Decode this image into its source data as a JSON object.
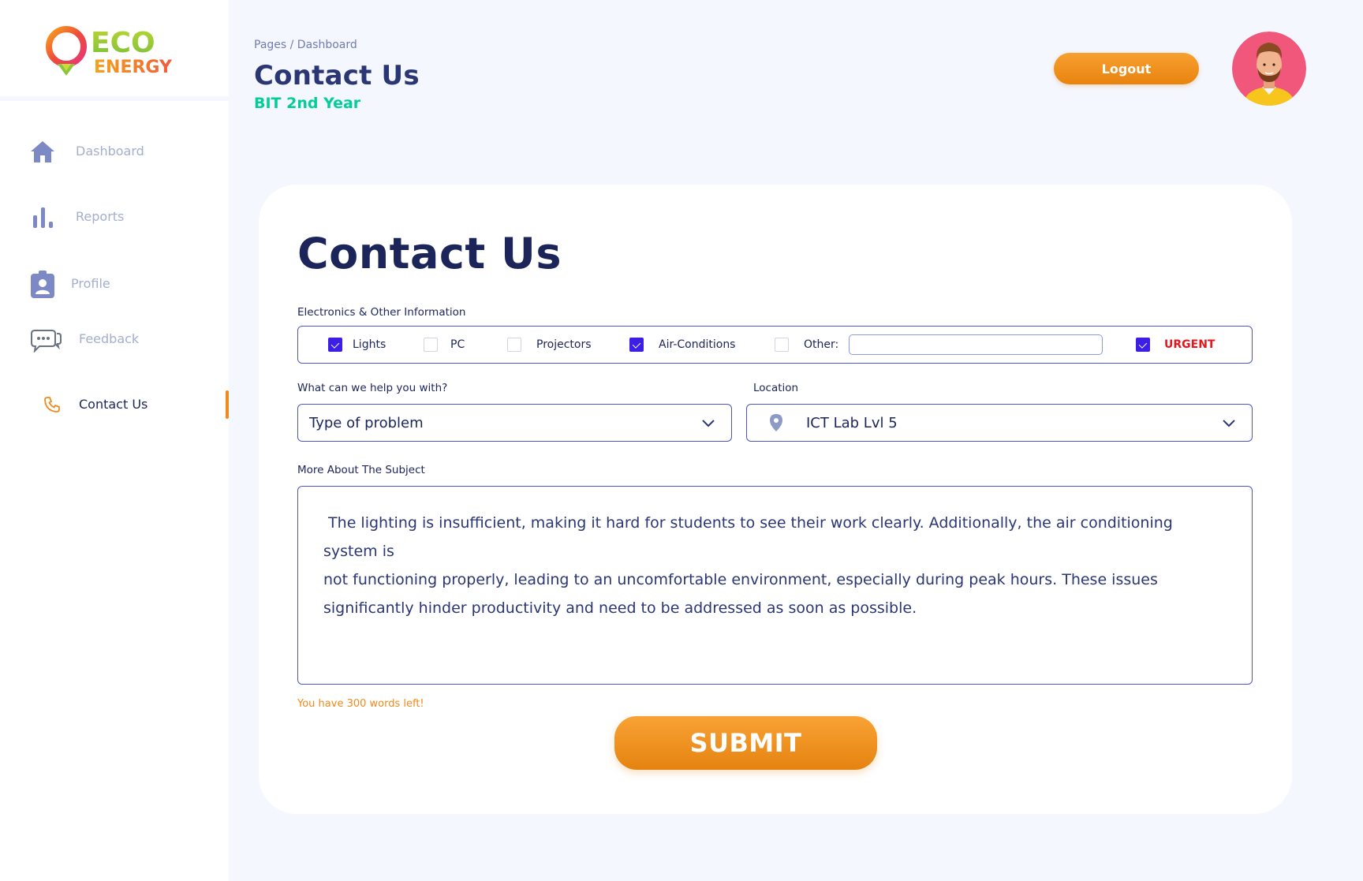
{
  "brand": {
    "line1": "ECO",
    "line2": "ENERGY"
  },
  "sidebar": {
    "items": [
      {
        "label": "Dashboard",
        "icon": "home-icon"
      },
      {
        "label": "Reports",
        "icon": "bar-chart-icon"
      },
      {
        "label": "Profile",
        "icon": "badge-icon"
      },
      {
        "label": "Feedback",
        "icon": "chat-bubbles-icon"
      },
      {
        "label": "Contact Us",
        "icon": "phone-icon",
        "active": true
      }
    ]
  },
  "header": {
    "breadcrumb": "Pages / Dashboard",
    "title": "Contact Us",
    "subtitle": "BIT 2nd Year",
    "logout_label": "Logout"
  },
  "form": {
    "title": "Contact Us",
    "electronics_label": "Electronics & Other Information",
    "options": [
      {
        "label": "Lights",
        "checked": true
      },
      {
        "label": "PC",
        "checked": false
      },
      {
        "label": "Projectors",
        "checked": false
      },
      {
        "label": "Air-Conditions",
        "checked": true
      },
      {
        "label": "Other:",
        "checked": false
      },
      {
        "label": "URGENT",
        "checked": true
      }
    ],
    "other_value": "",
    "help_label": "What can we help you with?",
    "help_value": "Type of problem",
    "location_label": "Location",
    "location_value": "ICT Lab Lvl 5",
    "more_label": "More About  The Subject",
    "message": " The lighting is insufficient, making it hard for students to see their work clearly. Additionally, the air conditioning system is\nnot functioning properly, leading to an uncomfortable environment, especially during peak hours. These issues\nsignificantly hinder productivity and need to be addressed as soon as possible.",
    "words_left": "You have 300 words left!",
    "submit_label": "SUBMIT"
  },
  "colors": {
    "accent": "#f08a1c",
    "primary": "#1b2559",
    "check": "#3d1ee6",
    "urgent": "#e8161b",
    "subtitle": "#05cd99"
  }
}
